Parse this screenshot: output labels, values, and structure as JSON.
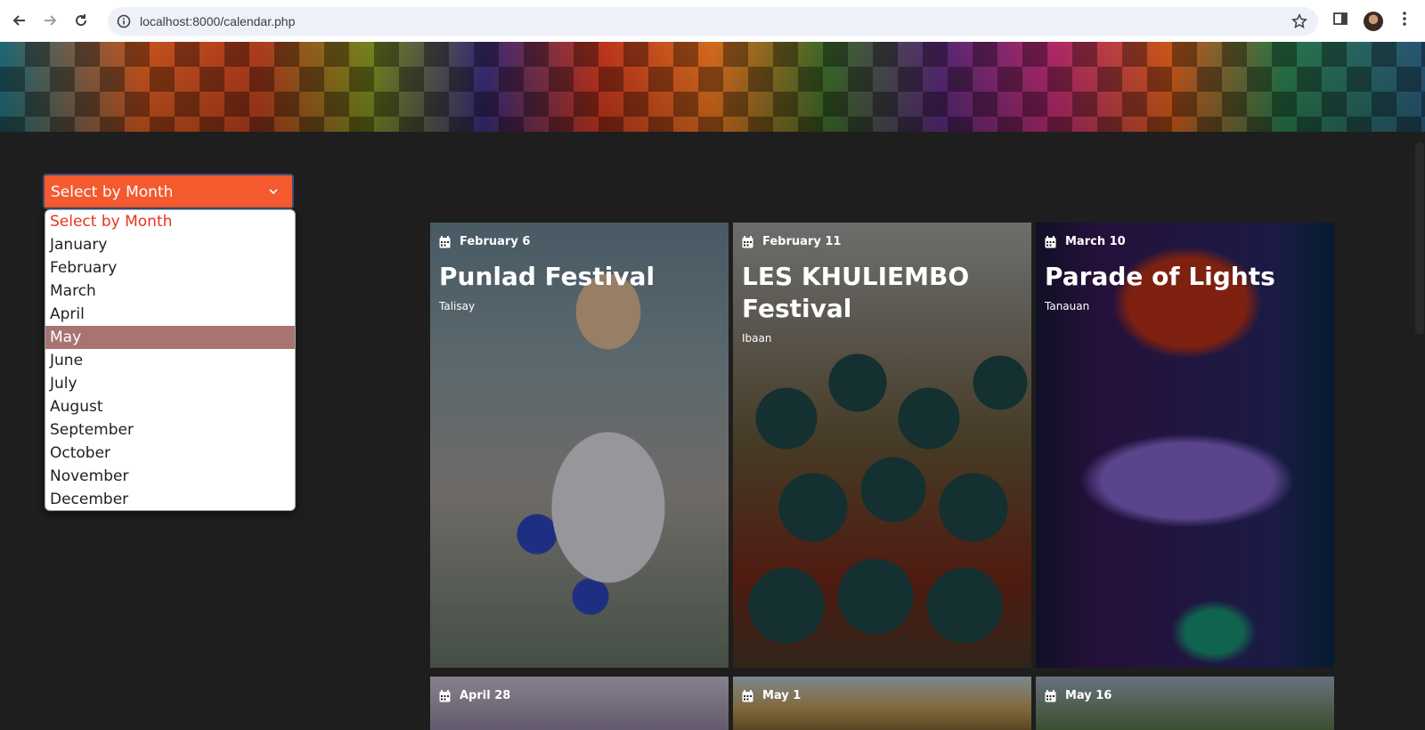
{
  "browser": {
    "url": "localhost:8000/calendar.php"
  },
  "filter": {
    "select_label": "Select by Month",
    "options": [
      "Select by Month",
      "January",
      "February",
      "March",
      "April",
      "May",
      "June",
      "July",
      "August",
      "September",
      "October",
      "November",
      "December"
    ],
    "highlighted": "May"
  },
  "cards": [
    {
      "date": "February 6",
      "title": "Punlad Festival",
      "location": "Talisay"
    },
    {
      "date": "February 11",
      "title": "LES KHULIEMBO Festival",
      "location": "Ibaan"
    },
    {
      "date": "March 10",
      "title": "Parade of Lights",
      "location": "Tanauan"
    },
    {
      "date": "April 28",
      "title": "",
      "location": ""
    },
    {
      "date": "May 1",
      "title": "",
      "location": ""
    },
    {
      "date": "May 16",
      "title": "",
      "location": ""
    }
  ],
  "colors": {
    "select_bg": "#f45a2e",
    "option_highlight": "#a87471",
    "placeholder_text": "#e8341d",
    "page_bg": "#1e1e1e"
  },
  "icons": {
    "date": "calendar-icon",
    "back": "back-arrow-icon",
    "forward": "forward-arrow-icon",
    "reload": "reload-icon",
    "site_info": "info-icon",
    "bookmark": "star-icon",
    "side_panel": "side-panel-icon",
    "menu": "kebab-menu-icon",
    "dropdown": "chevron-down-icon"
  }
}
